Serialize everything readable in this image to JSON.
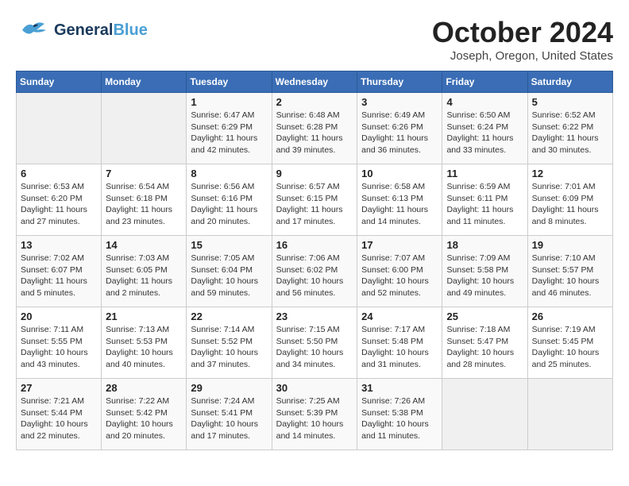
{
  "header": {
    "logo_line1": "General",
    "logo_line2": "Blue",
    "month": "October 2024",
    "location": "Joseph, Oregon, United States"
  },
  "weekdays": [
    "Sunday",
    "Monday",
    "Tuesday",
    "Wednesday",
    "Thursday",
    "Friday",
    "Saturday"
  ],
  "weeks": [
    [
      {
        "day": "",
        "info": ""
      },
      {
        "day": "",
        "info": ""
      },
      {
        "day": "1",
        "info": "Sunrise: 6:47 AM\nSunset: 6:29 PM\nDaylight: 11 hours and 42 minutes."
      },
      {
        "day": "2",
        "info": "Sunrise: 6:48 AM\nSunset: 6:28 PM\nDaylight: 11 hours and 39 minutes."
      },
      {
        "day": "3",
        "info": "Sunrise: 6:49 AM\nSunset: 6:26 PM\nDaylight: 11 hours and 36 minutes."
      },
      {
        "day": "4",
        "info": "Sunrise: 6:50 AM\nSunset: 6:24 PM\nDaylight: 11 hours and 33 minutes."
      },
      {
        "day": "5",
        "info": "Sunrise: 6:52 AM\nSunset: 6:22 PM\nDaylight: 11 hours and 30 minutes."
      }
    ],
    [
      {
        "day": "6",
        "info": "Sunrise: 6:53 AM\nSunset: 6:20 PM\nDaylight: 11 hours and 27 minutes."
      },
      {
        "day": "7",
        "info": "Sunrise: 6:54 AM\nSunset: 6:18 PM\nDaylight: 11 hours and 23 minutes."
      },
      {
        "day": "8",
        "info": "Sunrise: 6:56 AM\nSunset: 6:16 PM\nDaylight: 11 hours and 20 minutes."
      },
      {
        "day": "9",
        "info": "Sunrise: 6:57 AM\nSunset: 6:15 PM\nDaylight: 11 hours and 17 minutes."
      },
      {
        "day": "10",
        "info": "Sunrise: 6:58 AM\nSunset: 6:13 PM\nDaylight: 11 hours and 14 minutes."
      },
      {
        "day": "11",
        "info": "Sunrise: 6:59 AM\nSunset: 6:11 PM\nDaylight: 11 hours and 11 minutes."
      },
      {
        "day": "12",
        "info": "Sunrise: 7:01 AM\nSunset: 6:09 PM\nDaylight: 11 hours and 8 minutes."
      }
    ],
    [
      {
        "day": "13",
        "info": "Sunrise: 7:02 AM\nSunset: 6:07 PM\nDaylight: 11 hours and 5 minutes."
      },
      {
        "day": "14",
        "info": "Sunrise: 7:03 AM\nSunset: 6:05 PM\nDaylight: 11 hours and 2 minutes."
      },
      {
        "day": "15",
        "info": "Sunrise: 7:05 AM\nSunset: 6:04 PM\nDaylight: 10 hours and 59 minutes."
      },
      {
        "day": "16",
        "info": "Sunrise: 7:06 AM\nSunset: 6:02 PM\nDaylight: 10 hours and 56 minutes."
      },
      {
        "day": "17",
        "info": "Sunrise: 7:07 AM\nSunset: 6:00 PM\nDaylight: 10 hours and 52 minutes."
      },
      {
        "day": "18",
        "info": "Sunrise: 7:09 AM\nSunset: 5:58 PM\nDaylight: 10 hours and 49 minutes."
      },
      {
        "day": "19",
        "info": "Sunrise: 7:10 AM\nSunset: 5:57 PM\nDaylight: 10 hours and 46 minutes."
      }
    ],
    [
      {
        "day": "20",
        "info": "Sunrise: 7:11 AM\nSunset: 5:55 PM\nDaylight: 10 hours and 43 minutes."
      },
      {
        "day": "21",
        "info": "Sunrise: 7:13 AM\nSunset: 5:53 PM\nDaylight: 10 hours and 40 minutes."
      },
      {
        "day": "22",
        "info": "Sunrise: 7:14 AM\nSunset: 5:52 PM\nDaylight: 10 hours and 37 minutes."
      },
      {
        "day": "23",
        "info": "Sunrise: 7:15 AM\nSunset: 5:50 PM\nDaylight: 10 hours and 34 minutes."
      },
      {
        "day": "24",
        "info": "Sunrise: 7:17 AM\nSunset: 5:48 PM\nDaylight: 10 hours and 31 minutes."
      },
      {
        "day": "25",
        "info": "Sunrise: 7:18 AM\nSunset: 5:47 PM\nDaylight: 10 hours and 28 minutes."
      },
      {
        "day": "26",
        "info": "Sunrise: 7:19 AM\nSunset: 5:45 PM\nDaylight: 10 hours and 25 minutes."
      }
    ],
    [
      {
        "day": "27",
        "info": "Sunrise: 7:21 AM\nSunset: 5:44 PM\nDaylight: 10 hours and 22 minutes."
      },
      {
        "day": "28",
        "info": "Sunrise: 7:22 AM\nSunset: 5:42 PM\nDaylight: 10 hours and 20 minutes."
      },
      {
        "day": "29",
        "info": "Sunrise: 7:24 AM\nSunset: 5:41 PM\nDaylight: 10 hours and 17 minutes."
      },
      {
        "day": "30",
        "info": "Sunrise: 7:25 AM\nSunset: 5:39 PM\nDaylight: 10 hours and 14 minutes."
      },
      {
        "day": "31",
        "info": "Sunrise: 7:26 AM\nSunset: 5:38 PM\nDaylight: 10 hours and 11 minutes."
      },
      {
        "day": "",
        "info": ""
      },
      {
        "day": "",
        "info": ""
      }
    ]
  ]
}
